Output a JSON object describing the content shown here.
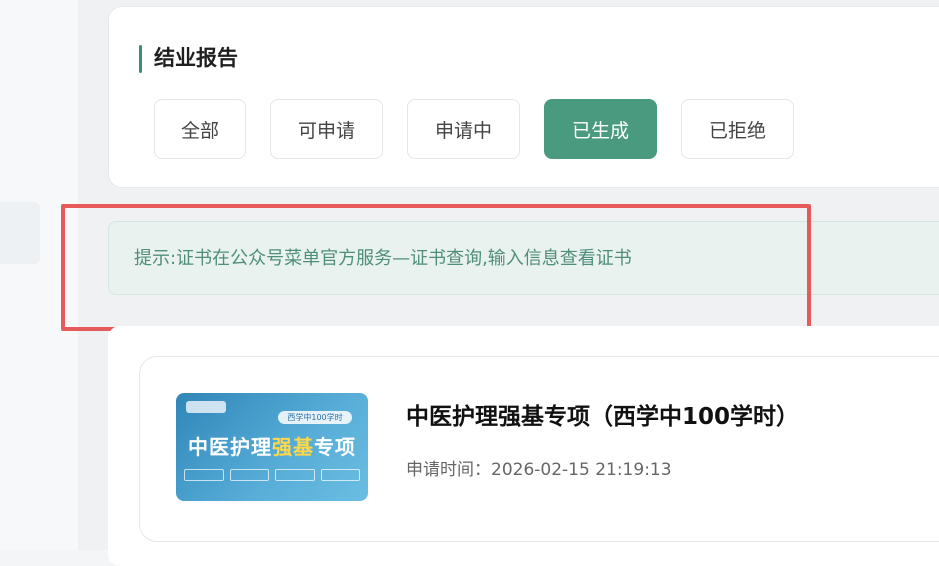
{
  "section": {
    "title": "结业报告"
  },
  "tabs": [
    {
      "label": "全部",
      "active": false
    },
    {
      "label": "可申请",
      "active": false
    },
    {
      "label": "申请中",
      "active": false
    },
    {
      "label": "已生成",
      "active": true
    },
    {
      "label": "已拒绝",
      "active": false
    }
  ],
  "tip": {
    "text": "提示:证书在公众号菜单官方服务—证书查询,输入信息查看证书"
  },
  "certificate": {
    "thumbnail": {
      "badge": "西学中100学时",
      "title_prefix": "中医护理",
      "title_highlight": "强基",
      "title_suffix": "专项"
    },
    "title": "中医护理强基专项（西学中100学时）",
    "apply_time_label": "申请时间：",
    "apply_time_value": "2026-02-15 21:19:13"
  },
  "colors": {
    "accent": "#4a9a80",
    "highlight_box": "#e65a5a",
    "tip_text": "#4f8e7b"
  }
}
